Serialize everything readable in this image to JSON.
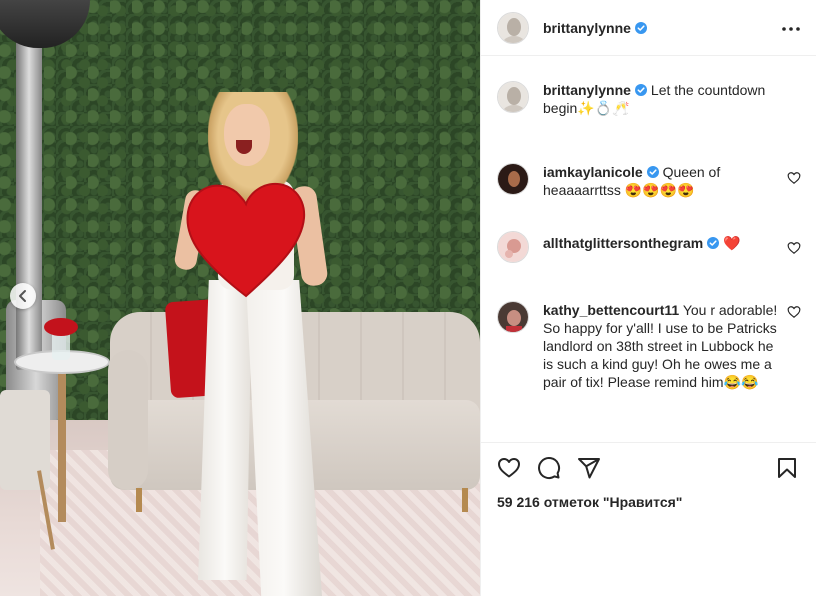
{
  "post": {
    "username": "brittanylynne",
    "verified": true
  },
  "caption": {
    "username": "brittanylynne",
    "text": "Let the countdown begin✨💍🥂"
  },
  "comments": [
    {
      "username": "iamkaylanicole",
      "verified": true,
      "text": "Queen of heaaaarrttss 😍😍😍😍"
    },
    {
      "username": "allthatglittersonthegram",
      "verified": true,
      "text": "❤️"
    },
    {
      "username": "kathy_bettencourt11",
      "verified": false,
      "text": "You r adorable! So happy for y'all! I use to be Patricks landlord on 38th street in Lubbock he is such a kind guy! Oh he owes me a pair of tix! Please remind him😂😂"
    }
  ],
  "likes_text": "59 216 отметок \"Нравится\"",
  "icons": {
    "more": "more-options-icon",
    "verified": "verified-badge-icon",
    "like": "heart-outline-icon",
    "comment": "comment-bubble-icon",
    "share": "paper-plane-icon",
    "save": "bookmark-icon",
    "carousel_prev": "chevron-left-icon"
  },
  "colors": {
    "verified_blue": "#3897f0",
    "text": "#262626",
    "heart_red": "#e0161e",
    "divider": "#efefef"
  }
}
